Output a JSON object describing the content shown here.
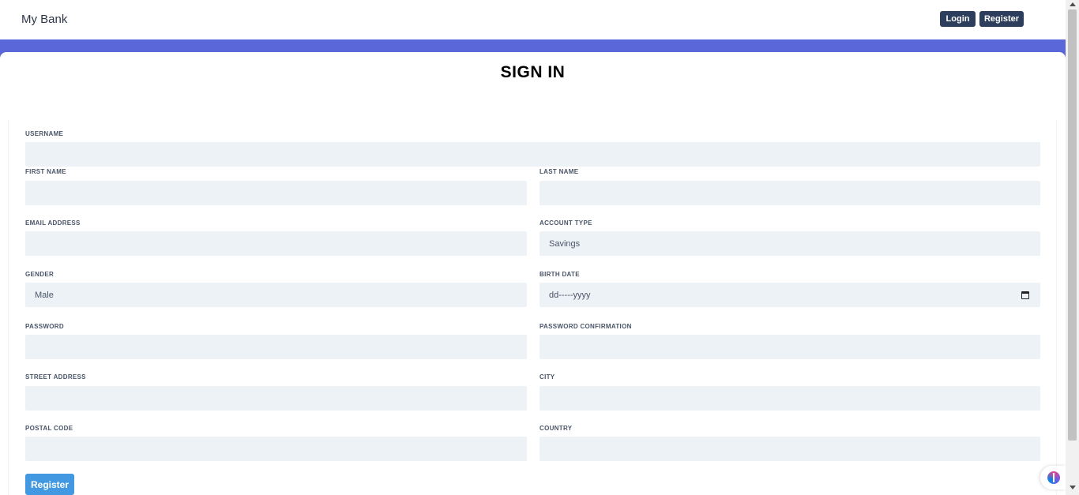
{
  "header": {
    "brand": "My Bank",
    "login_label": "Login",
    "register_label": "Register"
  },
  "page": {
    "title": "SIGN IN"
  },
  "form": {
    "username": {
      "label": "USERNAME",
      "value": ""
    },
    "first_name": {
      "label": "FIRST NAME",
      "value": ""
    },
    "last_name": {
      "label": "LAST NAME",
      "value": ""
    },
    "email": {
      "label": "EMAIL ADDRESS",
      "value": ""
    },
    "account_type": {
      "label": "ACCOUNT TYPE",
      "value": "Savings"
    },
    "gender": {
      "label": "GENDER",
      "value": "Male"
    },
    "birth_date": {
      "label": "BIRTH DATE",
      "placeholder": "dd-----yyyy"
    },
    "password": {
      "label": "PASSWORD",
      "value": ""
    },
    "password_confirmation": {
      "label": "PASSWORD CONFIRMATION",
      "value": ""
    },
    "street_address": {
      "label": "STREET ADDRESS",
      "value": ""
    },
    "city": {
      "label": "CITY",
      "value": ""
    },
    "postal_code": {
      "label": "POSTAL CODE",
      "value": ""
    },
    "country": {
      "label": "COUNTRY",
      "value": ""
    },
    "submit_label": "Register"
  },
  "icons": {
    "calendar": "calendar-icon",
    "assistant": "brain-icon"
  },
  "colors": {
    "accent_band": "#5a67d8",
    "nav_button": "#2d3e5c",
    "submit_button": "#4299e1",
    "field_background": "#edf2f7"
  }
}
